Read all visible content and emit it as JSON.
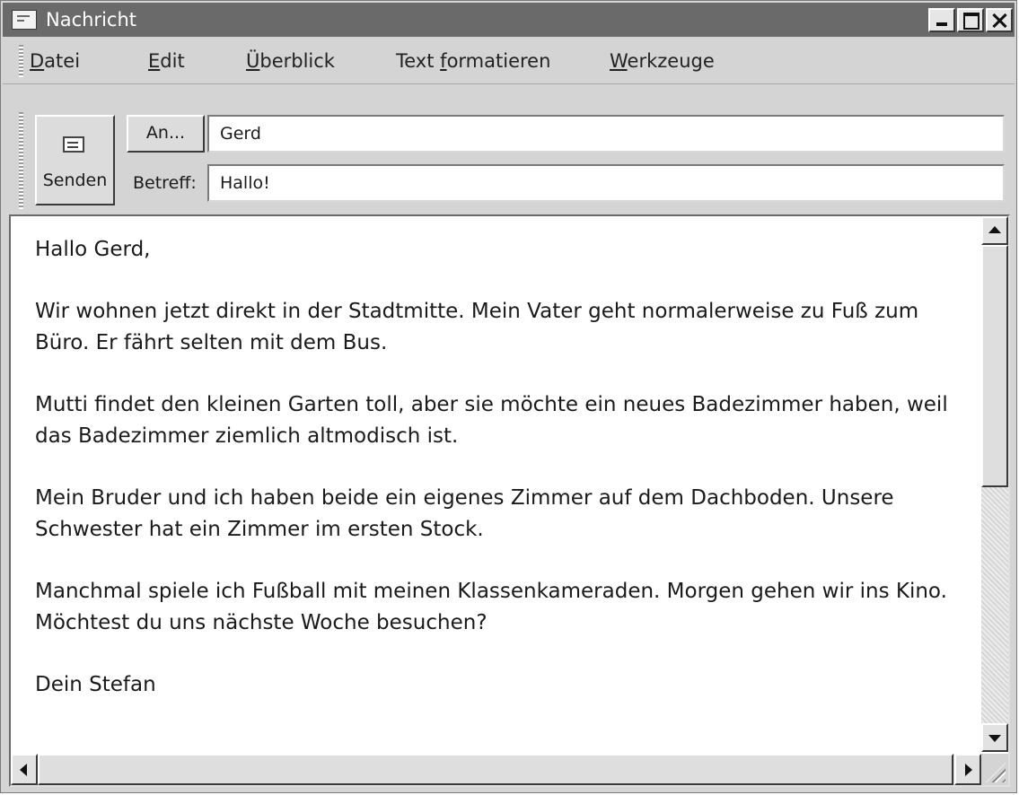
{
  "window": {
    "title": "Nachricht"
  },
  "menu": {
    "items": [
      {
        "accel": "D",
        "rest": "atei"
      },
      {
        "accel": "E",
        "rest": "dit"
      },
      {
        "accel": "Ü",
        "rest": "berblick"
      },
      {
        "pre": "Text ",
        "accel": "f",
        "rest": "ormatieren"
      },
      {
        "accel": "W",
        "rest": "erkzeuge"
      }
    ]
  },
  "header": {
    "send_label": "Senden",
    "to_button_label": "An...",
    "to_value": "Gerd",
    "subject_label": "Betreff:",
    "subject_value": "Hallo!"
  },
  "message": {
    "greeting": "Hallo Gerd,",
    "paragraphs": [
      "Wir wohnen jetzt direkt in der Stadtmitte. Mein Vater geht normalerweise zu Fuß zum Büro. Er fährt selten mit dem Bus.",
      "Mutti findet den kleinen Garten toll, aber sie möchte ein neues Badezimmer haben, weil das Badezimmer ziemlich altmodisch ist.",
      "Mein Bruder und ich haben beide ein eigenes Zimmer auf dem Dachboden. Unsere Schwester hat ein Zimmer im ersten Stock.",
      "Manchmal spiele ich Fußball mit meinen Klassenkameraden. Morgen gehen wir ins Kino. Möchtest du uns nächste Woche besuchen?"
    ],
    "signature": "Dein Stefan"
  }
}
